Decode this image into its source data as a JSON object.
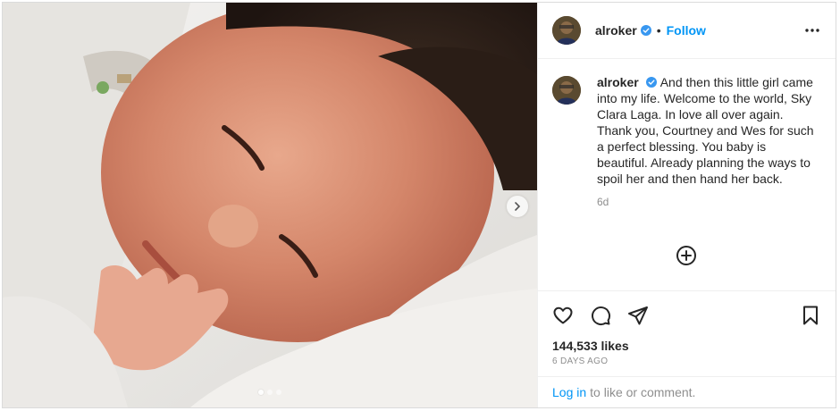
{
  "post": {
    "author": "alroker",
    "follow_label": "Follow",
    "separator": "•",
    "caption": "And then this little girl came into my life. Welcome to the world, Sky Clara Laga. In love all over again. Thank you, Courtney and Wes for such a perfect blessing. You baby is beautiful. Already planning the ways to spoil her and then hand her back.",
    "time_ago": "6d",
    "likes": "144,533 likes",
    "date": "6 DAYS AGO",
    "carousel": {
      "slide_count": 3,
      "active_slide": 1
    }
  },
  "footer": {
    "login_link": "Log in",
    "login_rest": "to like or comment."
  },
  "icons": {
    "verified": "verified-badge-icon",
    "more": "more-options-icon",
    "next": "chevron-right-icon",
    "add_comment": "add-comment-icon",
    "like": "heart-icon",
    "comment": "comment-icon",
    "share": "share-icon",
    "save": "bookmark-icon"
  },
  "colors": {
    "accent": "#0095f6",
    "text": "#262626",
    "muted": "#8e8e8e",
    "border": "#dbdbdb"
  }
}
